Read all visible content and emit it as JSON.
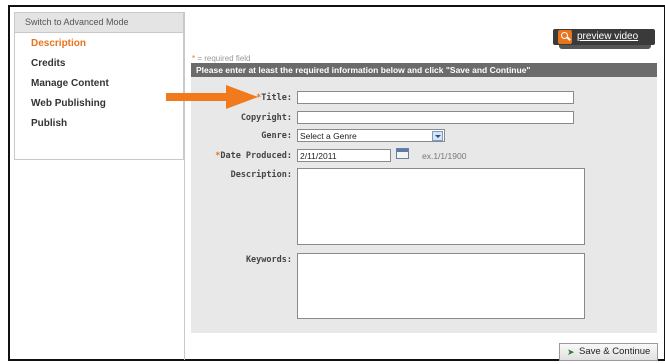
{
  "sidebar": {
    "header": "Switch to Advanced Mode",
    "items": [
      {
        "label": "Description",
        "active": true
      },
      {
        "label": "Credits"
      },
      {
        "label": "Manage Content"
      },
      {
        "label": "Web Publishing"
      },
      {
        "label": "Publish"
      }
    ]
  },
  "preview": {
    "label": "preview video"
  },
  "required_note": {
    "star": "*",
    "text": " = required field"
  },
  "form": {
    "instruction": "Please enter at least the required information below and click \"Save and Continue\"",
    "title": {
      "star": "*",
      "label": "Title:",
      "value": ""
    },
    "copyright": {
      "label": "Copyright:",
      "value": ""
    },
    "genre": {
      "label": "Genre:",
      "selected": "Select a Genre"
    },
    "date_produced": {
      "star": "*",
      "label": "Date Produced:",
      "value": "2/11/2011",
      "hint": "ex.1/1/1900"
    },
    "description": {
      "label": "Description:",
      "value": ""
    },
    "keywords": {
      "label": "Keywords:",
      "value": ""
    }
  },
  "save_button": {
    "label": "Save & Continue"
  },
  "colors": {
    "accent": "#e8741c",
    "arrow": "#f07a1c",
    "header_bar": "#6b6b6b",
    "panel": "#e8e8e8"
  }
}
